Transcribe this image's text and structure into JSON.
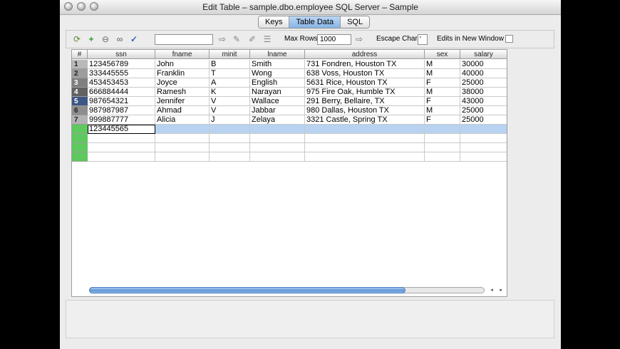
{
  "window": {
    "title": "Edit Table – sample.dbo.employee SQL Server – Sample"
  },
  "tabs": [
    {
      "label": "Keys",
      "active": false
    },
    {
      "label": "Table Data",
      "active": true
    },
    {
      "label": "SQL",
      "active": false
    }
  ],
  "toolbar": {
    "icons": [
      "refresh-icon",
      "add-row-icon",
      "delete-row-icon",
      "find-icon",
      "commit-check-icon",
      "arrow-right-icon",
      "edit-pencil-icon",
      "pencil-alt-icon",
      "filter-icon"
    ],
    "search_value": "",
    "max_rows_label": "Max Rows",
    "max_rows_value": "1000",
    "escape_char_label": "Escape Char",
    "escape_char_value": "'",
    "edits_window_label": "Edits in New Window",
    "edits_window_checked": false
  },
  "table": {
    "columns": [
      "#",
      "ssn",
      "fname",
      "minit",
      "lname",
      "address",
      "sex",
      "salary"
    ],
    "rows": [
      {
        "num": "1",
        "ssn": "123456789",
        "fname": "John",
        "minit": "B",
        "lname": "Smith",
        "address": "731 Fondren, Houston TX",
        "sex": "M",
        "salary": "30000"
      },
      {
        "num": "2",
        "ssn": "333445555",
        "fname": "Franklin",
        "minit": "T",
        "lname": "Wong",
        "address": "638 Voss, Houston TX",
        "sex": "M",
        "salary": "40000"
      },
      {
        "num": "3",
        "ssn": "453453453",
        "fname": "Joyce",
        "minit": "A",
        "lname": "English",
        "address": "5631 Rice, Houston TX",
        "sex": "F",
        "salary": "25000"
      },
      {
        "num": "4",
        "ssn": "666884444",
        "fname": "Ramesh",
        "minit": "K",
        "lname": "Narayan",
        "address": "975 Fire Oak, Humble TX",
        "sex": "M",
        "salary": "38000"
      },
      {
        "num": "5",
        "ssn": "987654321",
        "fname": "Jennifer",
        "minit": "V",
        "lname": "Wallace",
        "address": "291 Berry, Bellaire, TX",
        "sex": "F",
        "salary": "43000"
      },
      {
        "num": "6",
        "ssn": "987987987",
        "fname": "Ahmad",
        "minit": "V",
        "lname": "Jabbar",
        "address": "980 Dallas, Houston TX",
        "sex": "M",
        "salary": "25000"
      },
      {
        "num": "7",
        "ssn": "999887777",
        "fname": "Alicia",
        "minit": "J",
        "lname": "Zelaya",
        "address": "3321 Castle, Spring TX",
        "sex": "F",
        "salary": "25000"
      }
    ],
    "edit_row": {
      "ssn": "123445565"
    },
    "row_number_colors": [
      "#b9b9b9",
      "#9d9d9d",
      "#7f7f7f",
      "#626262",
      "#3e5684",
      "#8e8e8e",
      "#b3b3b3"
    ],
    "new_row_color": "#5ec95e",
    "selected_row_color": "#b8d3f2"
  },
  "scrollbar": {
    "thumb_fraction": 0.8
  }
}
